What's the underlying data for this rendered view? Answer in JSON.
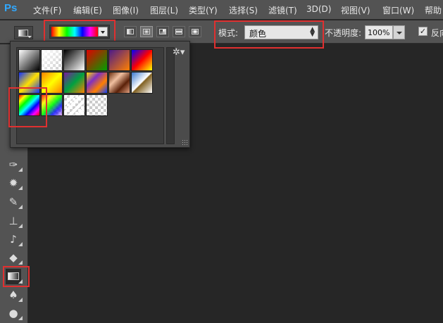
{
  "app": {
    "logo": "Ps"
  },
  "menu": {
    "items": [
      "文件(F)",
      "编辑(E)",
      "图像(I)",
      "图层(L)",
      "类型(Y)",
      "选择(S)",
      "滤镜(T)",
      "3D(D)",
      "视图(V)",
      "窗口(W)",
      "帮助"
    ]
  },
  "options": {
    "mode_label": "模式:",
    "mode_value": "颜色",
    "opacity_label": "不透明度:",
    "opacity_value": "100%",
    "reverse_label": "反向",
    "reverse_checked": true
  },
  "panel": {
    "gear_icon": "gear-icon",
    "presets": [
      "foreground-to-background",
      "foreground-to-transparent",
      "black-white",
      "red-green",
      "violet-orange",
      "blue-red-yellow",
      "blue-yellow-blue",
      "orange-yellow-orange",
      "violet-green-orange",
      "yellow-violet-orange-blue",
      "copper",
      "chrome",
      "spectrum",
      "transparent-rainbow",
      "transparent-stripes",
      "checker-transparent"
    ]
  },
  "toolbox": {
    "tools": [
      "eyedropper-icon",
      "spot-healing-icon",
      "brush-icon",
      "clone-stamp-icon",
      "history-brush-icon",
      "eraser-icon",
      "gradient-icon",
      "blur-icon",
      "dodge-icon"
    ]
  },
  "colors": {
    "highlight": "#e03030",
    "ui_bg": "#535353",
    "canvas": "#262626"
  }
}
